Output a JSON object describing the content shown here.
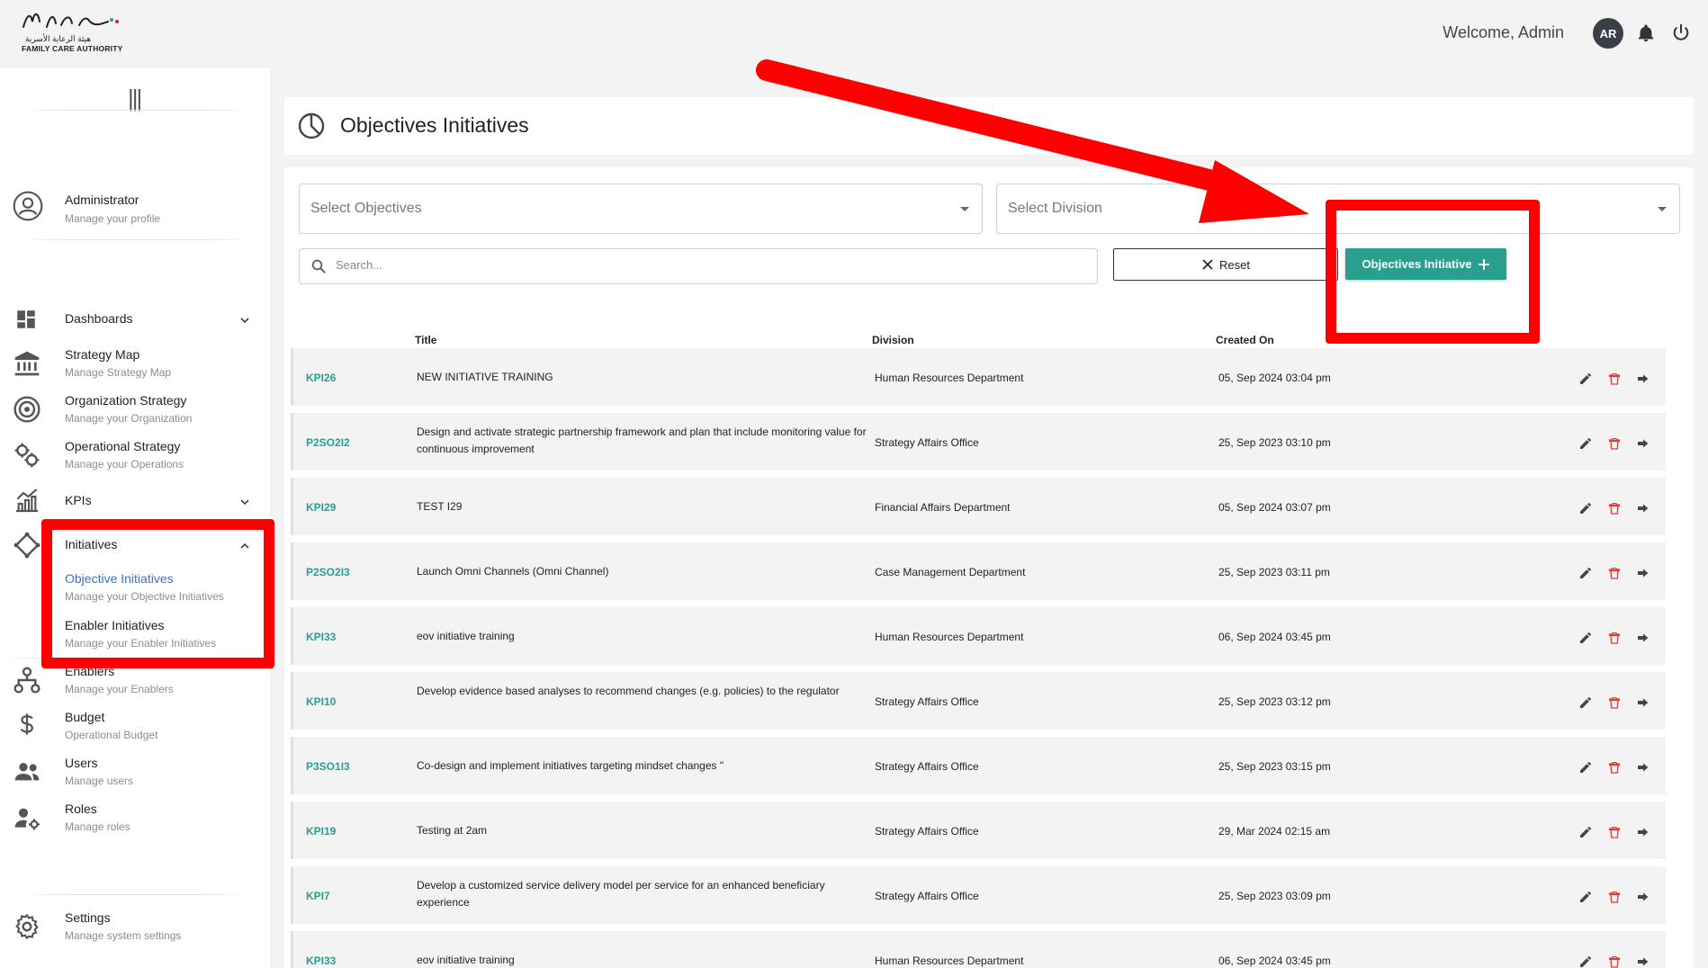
{
  "header": {
    "logo_text_ar": "هيئة الرعاية الأسرية",
    "logo_text_en": "FAMILY CARE AUTHORITY",
    "welcome_text": "Welcome,  Admin",
    "avatar_initials": "AR"
  },
  "sidebar": {
    "profile": {
      "title": "Administrator",
      "subtitle": "Manage your profile"
    },
    "items": [
      {
        "title": "Dashboards",
        "subtitle": ""
      },
      {
        "title": "Strategy Map",
        "subtitle": "Manage Strategy Map"
      },
      {
        "title": "Organization Strategy",
        "subtitle": "Manage your Organization"
      },
      {
        "title": "Operational Strategy",
        "subtitle": "Manage your Operations"
      },
      {
        "title": "KPIs",
        "subtitle": ""
      },
      {
        "title": "Initiatives",
        "subtitle": ""
      },
      {
        "title": "Objective Initiatives",
        "subtitle": "Manage your Objective Initiatives"
      },
      {
        "title": "Enabler Initiatives",
        "subtitle": "Manage your Enabler Initiatives"
      },
      {
        "title": "Enablers",
        "subtitle": "Manage your Enablers"
      },
      {
        "title": "Budget",
        "subtitle": "Operational Budget"
      },
      {
        "title": "Users",
        "subtitle": "Manage users"
      },
      {
        "title": "Roles",
        "subtitle": "Manage roles"
      },
      {
        "title": "Settings",
        "subtitle": "Manage system settings"
      }
    ]
  },
  "page": {
    "title": "Objectives Initiatives"
  },
  "filters": {
    "objectives_placeholder": "Select Objectives",
    "division_placeholder": "Select Division",
    "search_placeholder": "Search...",
    "reset_label": "Reset",
    "add_label": "Objectives Initiative"
  },
  "table": {
    "headers": {
      "title": "Title",
      "division": "Division",
      "created_on": "Created On"
    },
    "rows": [
      {
        "code": "KPI26",
        "title": "NEW INITIATIVE TRAINING",
        "division": "Human Resources Department",
        "created": "05, Sep 2024 03:04 pm"
      },
      {
        "code": "P2SO2I2",
        "title": "Design and activate strategic partnership framework and plan that include monitoring value for continuous improvement",
        "division": "Strategy Affairs Office",
        "created": "25, Sep 2023 03:10 pm"
      },
      {
        "code": "KPI29",
        "title": "TEST I29",
        "division": "Financial Affairs Department",
        "created": "05, Sep 2024 03:07 pm"
      },
      {
        "code": "P2SO2I3",
        "title": "Launch Omni Channels (Omni Channel)",
        "division": "Case Management Department",
        "created": "25, Sep 2023 03:11 pm"
      },
      {
        "code": "KPI33",
        "title": "eov initiative training",
        "division": "Human Resources Department",
        "created": "06, Sep 2024 03:45 pm"
      },
      {
        "code": "KPI10",
        "title": "Develop evidence based analyses to recommend changes (e.g. policies) to the regulator",
        "division": "Strategy Affairs Office",
        "created": "25, Sep 2023 03:12 pm"
      },
      {
        "code": "P3SO1I3",
        "title": "Co-design and implement initiatives targeting mindset changes \"",
        "division": "Strategy Affairs Office",
        "created": "25, Sep 2023 03:15 pm"
      },
      {
        "code": "KPI19",
        "title": "Testing at 2am",
        "division": "Strategy Affairs Office",
        "created": "29, Mar 2024 02:15 am"
      },
      {
        "code": "KPI7",
        "title": "Develop a customized service delivery model per service for an enhanced beneficiary experience",
        "division": "Strategy Affairs Office",
        "created": "25, Sep 2023 03:09 pm"
      },
      {
        "code": "KPI33",
        "title": "eov initiative training",
        "division": "Human Resources Department",
        "created": "06, Sep 2024 03:45 pm"
      }
    ]
  },
  "colors": {
    "accent": "#2b9f8e",
    "active_link": "#3a6fd8",
    "annotation": "#ff0000",
    "delete_icon": "#e53935"
  }
}
